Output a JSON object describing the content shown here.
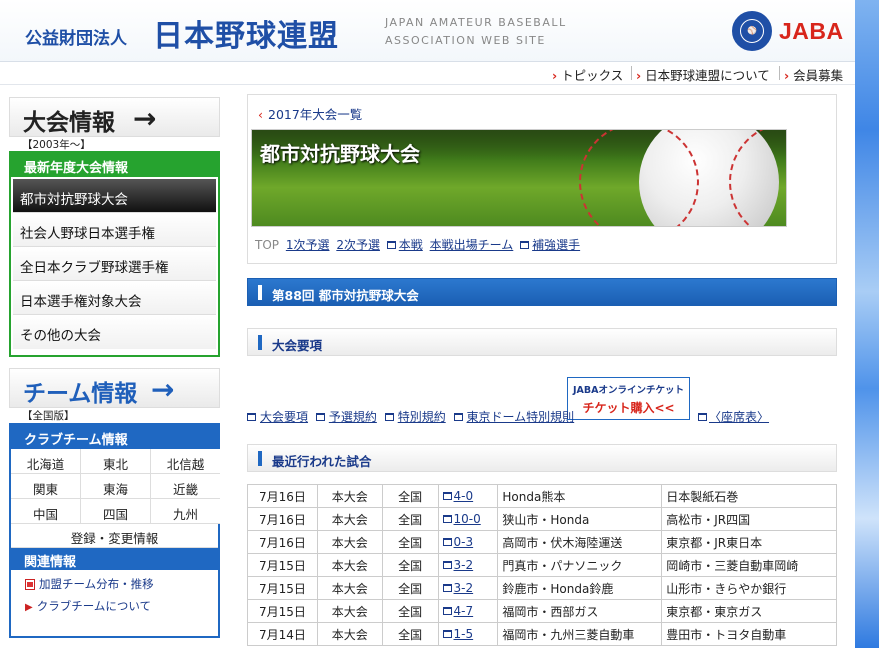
{
  "header": {
    "org_prefix": "公益財団法人",
    "org_name": "日本野球連盟",
    "eng_line1": "JAPAN AMATEUR BASEBALL",
    "eng_line2": "ASSOCIATION WEB SITE",
    "brand": "JABA",
    "seal_text": "JAPAN AMATEUR BASEBALL ASSOCIATION"
  },
  "topnav": [
    "トピックス",
    "日本野球連盟について",
    "会員募集"
  ],
  "sidebar": {
    "tournament": {
      "title": "大会情報",
      "period": "【2003年～】",
      "section": "最新年度大会情報",
      "items": [
        "都市対抗野球大会",
        "社会人野球日本選手権",
        "全日本クラブ野球選手権",
        "日本選手権対象大会",
        "その他の大会"
      ]
    },
    "team": {
      "title": "チーム情報",
      "edition": "【全国版】",
      "section": "クラブチーム情報",
      "regions": [
        "北海道",
        "東北",
        "北信越",
        "関東",
        "東海",
        "近畿",
        "中国",
        "四国",
        "九州"
      ],
      "register": "登録・変更情報",
      "related_title": "関連情報",
      "related_links": [
        "加盟チーム分布・推移",
        "クラブチームについて"
      ]
    }
  },
  "main": {
    "back_link": "2017年大会一覧",
    "banner_title": "都市対抗野球大会",
    "tabs": [
      "TOP",
      "1次予選",
      "2次予選",
      "本戦",
      "本戦出場チーム",
      "補強選手"
    ],
    "event_heading": "第88回 都市対抗野球大会",
    "outline_heading": "大会要項",
    "doc_links": [
      "大会要項",
      "予選規約",
      "特別規約",
      "東京ドーム特別規則"
    ],
    "ticket_line1": "JABAオンラインチケット",
    "ticket_line2": "チケット購入<<",
    "seat_link": "〈座席表〉",
    "recent_heading": "最近行われた試合",
    "games": [
      {
        "date": "7月16日",
        "stage": "本大会",
        "area": "全国",
        "score": "4-0",
        "winner": "Honda熊本",
        "loser": "日本製紙石巻"
      },
      {
        "date": "7月16日",
        "stage": "本大会",
        "area": "全国",
        "score": "10-0",
        "winner": "狭山市・Honda",
        "loser": "高松市・JR四国"
      },
      {
        "date": "7月16日",
        "stage": "本大会",
        "area": "全国",
        "score": "0-3",
        "winner": "高岡市・伏木海陸運送",
        "loser": "東京都・JR東日本"
      },
      {
        "date": "7月15日",
        "stage": "本大会",
        "area": "全国",
        "score": "3-2",
        "winner": "門真市・パナソニック",
        "loser": "岡崎市・三菱自動車岡崎"
      },
      {
        "date": "7月15日",
        "stage": "本大会",
        "area": "全国",
        "score": "3-2",
        "winner": "鈴鹿市・Honda鈴鹿",
        "loser": "山形市・きらやか銀行"
      },
      {
        "date": "7月15日",
        "stage": "本大会",
        "area": "全国",
        "score": "4-7",
        "winner": "福岡市・西部ガス",
        "loser": "東京都・東京ガス"
      },
      {
        "date": "7月14日",
        "stage": "本大会",
        "area": "全国",
        "score": "1-5",
        "winner": "福岡市・九州三菱自動車",
        "loser": "豊田市・トヨタ自動車"
      }
    ]
  }
}
